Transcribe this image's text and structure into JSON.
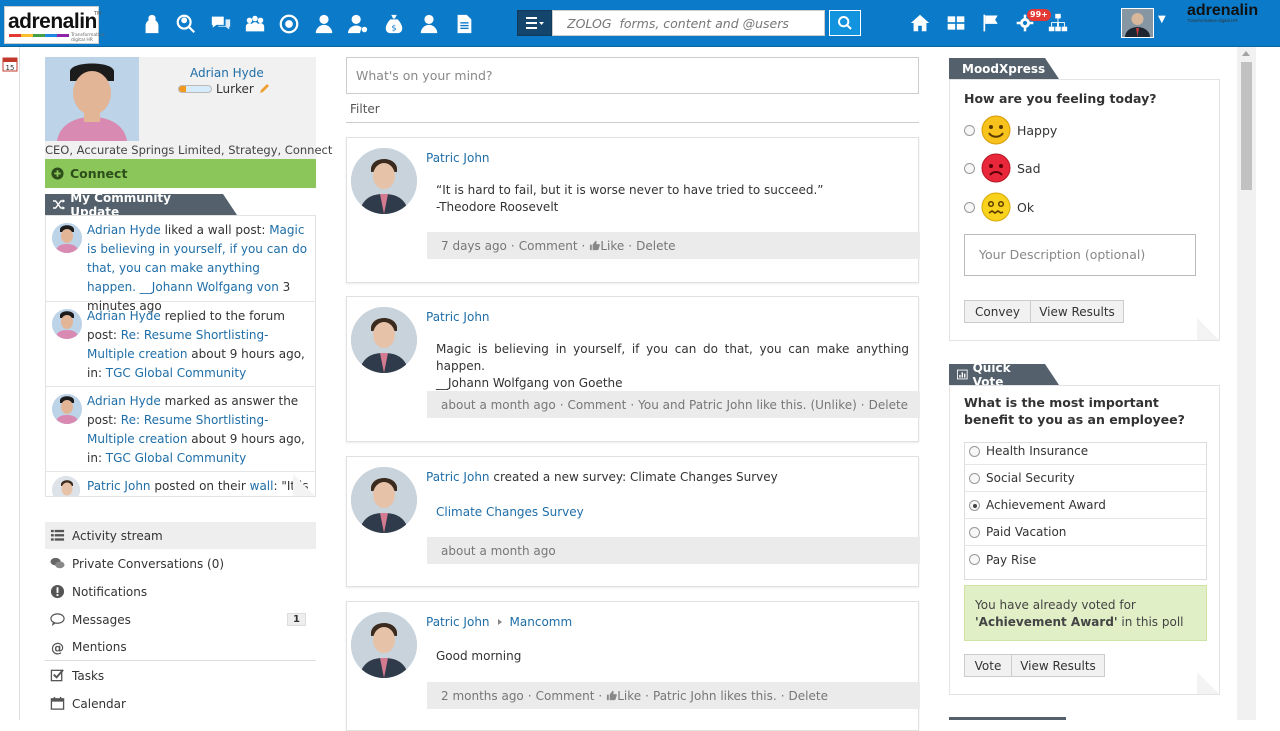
{
  "header": {
    "logo_text": "adrenalin",
    "logo_tagline": "Transformative digital HR",
    "brand_right": "adrenalin",
    "brand_right_sub": "Transformative digital HR",
    "search_placeholder": "ZOLOG  forms, content and @users",
    "notification_count": "99+",
    "nav_icons": [
      "people-icon",
      "search-people-icon",
      "chat-icon",
      "team-icon",
      "recycle-icon",
      "user-icon",
      "user-settings-icon",
      "money-bag-icon",
      "person-icon",
      "document-icon"
    ],
    "right_icons": [
      "home-icon",
      "dashboard-icon",
      "flag-icon",
      "gear-notification-icon",
      "org-chart-icon"
    ],
    "accent": "#0b7bc9"
  },
  "profile": {
    "name": "Adrian Hyde",
    "rank": "Lurker",
    "title": "CEO, Accurate Springs Limited, Strategy, Connect",
    "connect_label": "Connect"
  },
  "community": {
    "title": "My Community Update",
    "updates": [
      {
        "user": "Adrian Hyde",
        "action": " liked a wall post: ",
        "link": "Magic is believing in yourself, if you can do that, you can make anything happen. __Johann Wolfgang von",
        "time": " 3 minutes ago"
      },
      {
        "user": "Adrian Hyde",
        "action": " replied to the forum post: ",
        "link": "Re: Resume Shortlisting- Multiple creation",
        "time": " about 9 hours ago, in: ",
        "place": "TGC Global Community"
      },
      {
        "user": "Adrian Hyde",
        "action": " marked as answer the post: ",
        "link": "Re: Resume Shortlisting- Multiple creation",
        "time": " about 9 hours ago, in: ",
        "place": "TGC Global Community"
      },
      {
        "user": "Patric John",
        "action": " posted on their ",
        "link": "wall",
        "time": ": \"It is"
      }
    ]
  },
  "menu": [
    {
      "label": "Activity stream",
      "icon": "list-icon"
    },
    {
      "label": "Private Conversations (0)",
      "icon": "conversations-icon"
    },
    {
      "label": "Notifications",
      "icon": "alert-icon"
    },
    {
      "label": "Messages",
      "icon": "message-icon",
      "count": "1"
    },
    {
      "label": "Mentions",
      "icon": "at-icon"
    },
    {
      "label": "Tasks",
      "icon": "check-icon"
    },
    {
      "label": "Calendar",
      "icon": "calendar-icon"
    }
  ],
  "feed": {
    "composer_placeholder": "What's on your mind?",
    "filter_label": "Filter",
    "posts": [
      {
        "author": "Patric John",
        "line1": "“It is hard to fail, but it is worse never to have tried to succeed.”",
        "line2": "-Theodore Roosevelt",
        "time": "7 days ago",
        "comment": "Comment",
        "like": "Like",
        "delete": "Delete"
      },
      {
        "author": "Patric John",
        "line1": "Magic is believing in yourself, if you can do that, you can make anything happen.",
        "line2": "__Johann Wolfgang von Goethe",
        "time": "about a month ago",
        "comment": "Comment",
        "likes_text": "You and Patric John like this.",
        "unlike": "(Unlike)",
        "delete": "Delete"
      },
      {
        "author": "Patric John",
        "action": " created a new survey: Climate Changes Survey",
        "survey_link": "Climate Changes Survey",
        "time": "about a month ago"
      },
      {
        "author": "Patric John",
        "target": "Mancomm",
        "line1": "Good morning",
        "time": "2 months ago",
        "comment": "Comment",
        "like": "Like",
        "likes_text": "Patric John likes this.",
        "delete": "Delete"
      }
    ]
  },
  "mood": {
    "title": "MoodXpress",
    "question": "How are you feeling today?",
    "options": [
      "Happy",
      "Sad",
      "Ok"
    ],
    "description_placeholder": "Your Description (optional)",
    "convey_label": "Convey",
    "view_results_label": "View Results"
  },
  "vote": {
    "title": "Quick Vote",
    "question": "What is the most important benefit to you as an employee?",
    "options": [
      "Health Insurance",
      "Social Security",
      "Achievement Award",
      "Paid Vacation",
      "Pay Rise"
    ],
    "selected_index": 2,
    "voted_prefix": "You have already voted for",
    "voted_choice": "'Achievement Award'",
    "voted_suffix": " in this poll",
    "vote_label": "Vote",
    "view_results_label": "View Results"
  },
  "calendar_day": "15"
}
